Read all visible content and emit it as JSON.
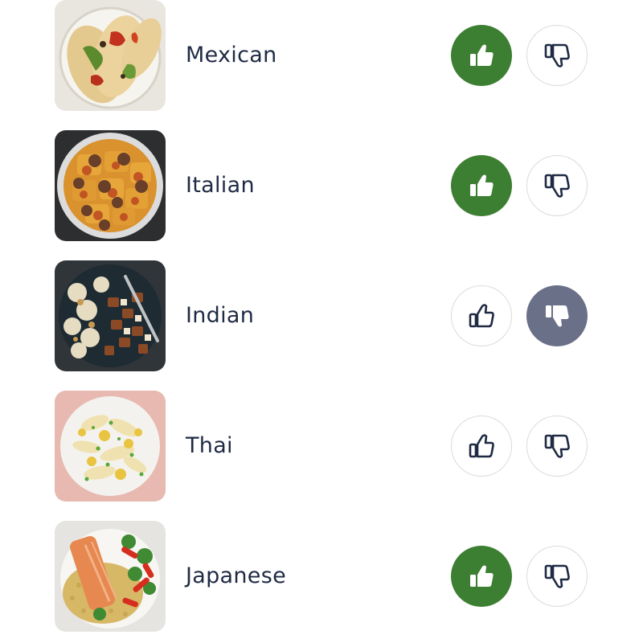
{
  "cuisines": [
    {
      "label": "Mexican",
      "vote": "like",
      "photo": "tacos-photo"
    },
    {
      "label": "Italian",
      "vote": "like",
      "photo": "ravioli-photo"
    },
    {
      "label": "Indian",
      "vote": "dislike",
      "photo": "curry-photo"
    },
    {
      "label": "Thai",
      "vote": "none",
      "photo": "noodles-photo"
    },
    {
      "label": "Japanese",
      "vote": "like",
      "photo": "salmon-rice-photo"
    }
  ],
  "colors": {
    "like_active": "#3d7f32",
    "dislike_active": "#6b7089",
    "icon_outline": "#1f2a44",
    "text": "#1f2a44",
    "border": "#d9dbe0"
  },
  "icons": {
    "like": "thumbs-up-icon",
    "dislike": "thumbs-down-icon"
  }
}
